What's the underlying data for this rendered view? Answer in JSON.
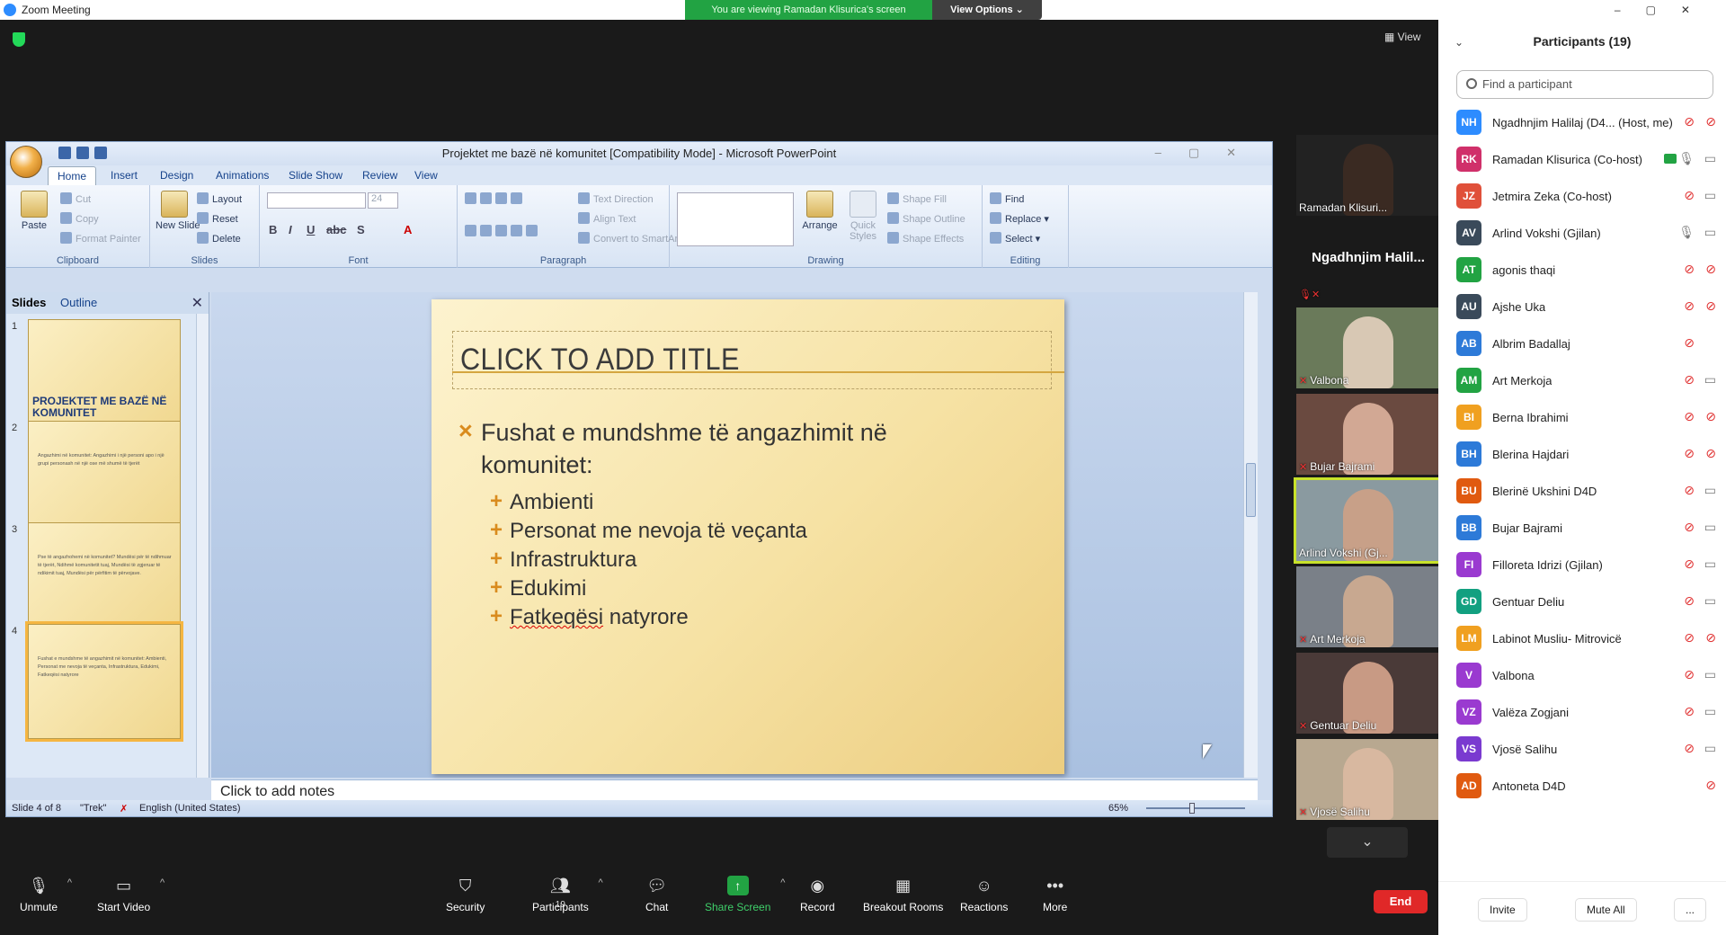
{
  "zoom": {
    "window_title": "Zoom Meeting",
    "viewing_banner": "You are viewing Ramadan Klisurica's screen",
    "view_options": "View Options",
    "view_button": "View"
  },
  "ppt": {
    "title": "Projektet me bazë në komunitet [Compatibility Mode] - Microsoft PowerPoint",
    "tabs": [
      "Home",
      "Insert",
      "Design",
      "Animations",
      "Slide Show",
      "Review",
      "View"
    ],
    "clipboard": {
      "paste": "Paste",
      "cut": "Cut",
      "copy": "Copy",
      "format_painter": "Format Painter",
      "label": "Clipboard"
    },
    "slides_group": {
      "new_slide": "New Slide",
      "layout": "Layout",
      "reset": "Reset",
      "delete": "Delete",
      "label": "Slides"
    },
    "font_group": {
      "label": "Font",
      "size": "24"
    },
    "paragraph_group": {
      "text_direction": "Text Direction",
      "align_text": "Align Text",
      "convert": "Convert to SmartArt",
      "label": "Paragraph"
    },
    "drawing_group": {
      "arrange": "Arrange",
      "quick_styles": "Quick Styles",
      "shape_fill": "Shape Fill",
      "shape_outline": "Shape Outline",
      "shape_effects": "Shape Effects",
      "label": "Drawing"
    },
    "editing_group": {
      "find": "Find",
      "replace": "Replace",
      "select": "Select",
      "label": "Editing"
    },
    "pane_tabs": {
      "slides": "Slides",
      "outline": "Outline"
    },
    "thumbnails": [
      {
        "num": "1",
        "title": "PROJEKTET ME BAZË NË KOMUNITET",
        "text": ""
      },
      {
        "num": "2",
        "title": "",
        "text": "Angazhimi në komunitet: Angazhimi i një personi apo i një grupi personash në një ose më shumë të tjerët"
      },
      {
        "num": "3",
        "title": "",
        "text": "Pse të angazhohemi në komunitet? Mundësi për të ndihmuar të tjerët, Ndihmë komunitetit tuaj, Mundësi të zgjeruar të ndikimit tuaj, Mundësi për përfitim të përvojave."
      },
      {
        "num": "4",
        "title": "",
        "text": "Fushat e mundshme të angazhimit në komunitet: Ambienti, Personat me nevoja të veçanta, Infrastruktura, Edukimi, Fatkeqësi natyrore"
      }
    ],
    "slide": {
      "title": "CLICK TO ADD TITLE",
      "bullet": "Fushat e mundshme të angazhimit në komunitet:",
      "subbullets": [
        "Ambienti",
        "Personat me nevoja të veçanta",
        "Infrastruktura",
        "Edukimi"
      ],
      "last_sub_a": "Fatkeqësi",
      "last_sub_b": " natyrore"
    },
    "notes": "Click to add notes",
    "status": {
      "slide": "Slide 4 of 8",
      "theme": "\"Trek\"",
      "language": "English (United States)",
      "zoom": "65%"
    }
  },
  "video_strip": [
    {
      "name": "Ramadan Klisuri...",
      "type": "video",
      "muted": false,
      "color": "#a9b2b9"
    },
    {
      "name": "Ngadhnjim Halil...",
      "type": "name",
      "muted": true,
      "color": "#1a1a1a"
    },
    {
      "name": "Valbona",
      "type": "video",
      "muted": true,
      "color": "#6a7a5a"
    },
    {
      "name": "Bujar Bajrami",
      "type": "video",
      "muted": true,
      "color": "#6a4a40"
    },
    {
      "name": "Arlind Vokshi (Gj...",
      "type": "video",
      "muted": false,
      "color": "#8a9aa0",
      "active": true
    },
    {
      "name": "Art Merkoja",
      "type": "video",
      "muted": true,
      "color": "#7a8088"
    },
    {
      "name": "Gentuar Deliu",
      "type": "video",
      "muted": true,
      "color": "#4a3a38"
    },
    {
      "name": "Vjosë Salihu",
      "type": "video",
      "muted": true,
      "color": "#b8a890"
    }
  ],
  "toolbar": {
    "unmute": "Unmute",
    "start_video": "Start Video",
    "security": "Security",
    "participants": "Participants",
    "participants_count": "19",
    "chat": "Chat",
    "share_screen": "Share Screen",
    "record": "Record",
    "breakout": "Breakout Rooms",
    "reactions": "Reactions",
    "more": "More",
    "end": "End"
  },
  "participants_panel": {
    "title": "Participants (19)",
    "search_placeholder": "Find a participant",
    "invite": "Invite",
    "mute_all": "Mute All",
    "more": "...",
    "list": [
      {
        "initials": "NH",
        "name": "Ngadhnjim Halilaj (D4...  (Host, me)",
        "color": "#2d8cff",
        "mic": "off",
        "cam": "off"
      },
      {
        "initials": "RK",
        "name": "Ramadan Klisurica (Co-host)",
        "color": "#d0306a",
        "mic": "on",
        "cam": "on",
        "share": true
      },
      {
        "initials": "JZ",
        "name": "Jetmira Zeka (Co-host)",
        "color": "#e0503a",
        "mic": "off",
        "cam": "on"
      },
      {
        "initials": "AV",
        "name": "Arlind Vokshi (Gjilan)",
        "color": "#3a4a5a",
        "mic": "on",
        "cam": "on"
      },
      {
        "initials": "AT",
        "name": "agonis thaqi",
        "color": "#22a343",
        "mic": "off",
        "cam": "off"
      },
      {
        "initials": "AU",
        "name": "Ajshe Uka",
        "color": "#3a4a5a",
        "mic": "off",
        "cam": "off"
      },
      {
        "initials": "AB",
        "name": "Albrim Badallaj",
        "color": "#2d7ad8",
        "mic": "off",
        "cam": "none"
      },
      {
        "initials": "AM",
        "name": "Art Merkoja",
        "color": "#22a343",
        "mic": "off",
        "cam": "on"
      },
      {
        "initials": "BI",
        "name": "Berna Ibrahimi",
        "color": "#f0a020",
        "mic": "off",
        "cam": "off"
      },
      {
        "initials": "BH",
        "name": "Blerina Hajdari",
        "color": "#2d7ad8",
        "mic": "off",
        "cam": "off"
      },
      {
        "initials": "BU",
        "name": "Blerinë Ukshini D4D",
        "color": "#e05a10",
        "mic": "off",
        "cam": "on"
      },
      {
        "initials": "BB",
        "name": "Bujar Bajrami",
        "color": "#2d7ad8",
        "mic": "off",
        "cam": "on"
      },
      {
        "initials": "FI",
        "name": "Filloreta Idrizi (Gjilan)",
        "color": "#9a3ad0",
        "mic": "off",
        "cam": "on"
      },
      {
        "initials": "GD",
        "name": "Gentuar Deliu",
        "color": "#12a080",
        "mic": "off",
        "cam": "on"
      },
      {
        "initials": "LM",
        "name": "Labinot Musliu- Mitrovicë",
        "color": "#f0a020",
        "mic": "off",
        "cam": "off"
      },
      {
        "initials": "V",
        "name": "Valbona",
        "color": "#9a3ad0",
        "mic": "off",
        "cam": "on"
      },
      {
        "initials": "VZ",
        "name": "Valëza Zogjani",
        "color": "#9a3ad0",
        "mic": "off",
        "cam": "on"
      },
      {
        "initials": "VS",
        "name": "Vjosë Salihu",
        "color": "#7a3ad0",
        "mic": "off",
        "cam": "on"
      },
      {
        "initials": "AD",
        "name": "Antoneta D4D",
        "color": "#e05a10",
        "mic": "none",
        "cam": "off"
      }
    ]
  }
}
